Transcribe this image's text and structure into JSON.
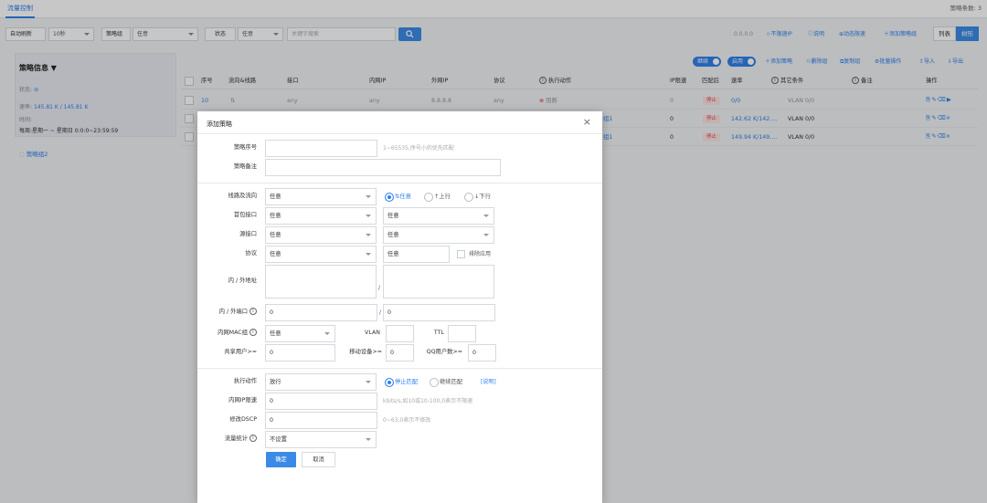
{
  "topbar": {
    "tab": "流量控制",
    "count": "策略条数: 3"
  },
  "toolbar": {
    "refresh_label": "自动刷新",
    "refresh_value": "10秒",
    "group_label": "策略组",
    "group_value": "任意",
    "status_label": "状态",
    "status_value": "任意",
    "search_placeholder": "关键字搜索",
    "version": "0.0.0.0",
    "links": [
      "不限速IP",
      "说明",
      "动态限速",
      "添加策略组"
    ],
    "view_list": "列表",
    "view_tree": "树形"
  },
  "left": {
    "title": "策略信息",
    "status_label": "状态:",
    "rate_label": "速率:",
    "rate_value": "145.81 K / 145.81 K",
    "time_label": "时间:",
    "time_value": "每周:星期一 ~ 星期日 0:0:0~23:59:59",
    "group2": "策略组2"
  },
  "actions": {
    "continue": "继续",
    "enable": "启用",
    "add": "添加策略",
    "delete_group": "删除组",
    "copy_group": "复制组",
    "batch": "批量操作",
    "import": "导入",
    "export": "导出"
  },
  "table": {
    "headers": [
      "序号",
      "流向&线路",
      "接口",
      "内网IP",
      "外网IP",
      "协议",
      "执行动作",
      "IP限速",
      "匹配后",
      "速率",
      "其它条件",
      "备注",
      "操作"
    ],
    "rows": [
      {
        "id": "10",
        "iface": "any",
        "inip": "any",
        "outip": "8.8.8.8",
        "proto": "any",
        "action": "阻断",
        "iplimit": "0",
        "after": "停止",
        "rate": "0/0",
        "other": "VLAN 0/0"
      },
      {
        "id": "",
        "iface": "",
        "inip": "",
        "outip": "",
        "proto": "",
        "action": "组1",
        "iplimit": "0",
        "after": "停止",
        "rate": "142.62 K/142....",
        "other": "VLAN 0/0"
      },
      {
        "id": "",
        "iface": "",
        "inip": "",
        "outip": "",
        "proto": "",
        "action": "组1",
        "iplimit": "0",
        "after": "停止",
        "rate": "149.94 K/149....",
        "other": "VLAN 0/0"
      }
    ]
  },
  "dialog": {
    "title": "添加策略",
    "seq_label": "策略序号",
    "seq_hint": "1~65535,序号小的优先匹配",
    "note_label": "策略备注",
    "line_label": "线路及流向",
    "line_value": "任意",
    "dir_any": "⇅任意",
    "dir_up": "↑上行",
    "dir_down": "↓下行",
    "first_iface_label": "首包接口",
    "first_iface_a": "任意",
    "first_iface_b": "任意",
    "src_iface_label": "源接口",
    "src_iface_a": "任意",
    "src_iface_b": "任意",
    "proto_label": "协议",
    "proto_a": "任意",
    "proto_b": "任意",
    "exclude_label": "排除应用",
    "addr_label": "内 / 外地址",
    "addr_sep": "/",
    "port_label": "内 / 外端口",
    "port_a": "0",
    "port_b": "0",
    "mac_label": "内网MAC组",
    "mac_value": "任意",
    "vlan_label": "VLAN",
    "ttl_label": "TTL",
    "share_label": "共享用户>=",
    "share_value": "0",
    "mobile_label": "移动设备>=",
    "mobile_value": "0",
    "qq_label": "QQ用户数>=",
    "qq_value": "0",
    "exec_label": "执行动作",
    "exec_value": "放行",
    "stop_match": "停止匹配",
    "cont_match": "继续匹配",
    "explain": "[说明]",
    "iplimit_label": "内网IP限速",
    "iplimit_value": "0",
    "iplimit_hint": "kbits/s,如10或10-100,0表示不限速",
    "dscp_label": "修改DSCP",
    "dscp_value": "0",
    "dscp_hint": "0~63,0表示不修改",
    "stat_label": "流量统计",
    "stat_value": "不设置",
    "ok": "确定",
    "cancel": "取消"
  }
}
